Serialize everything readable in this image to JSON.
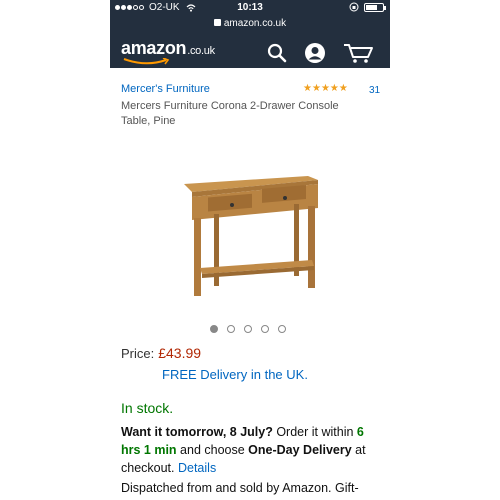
{
  "status_bar": {
    "carrier": "O2-UK",
    "time": "10:13",
    "url": "amazon.co.uk"
  },
  "header": {
    "logo_text": "amazon",
    "logo_tld": ".co.uk",
    "icons": [
      "search-icon",
      "account-icon",
      "cart-icon"
    ],
    "color_bg": "#232f3e"
  },
  "product": {
    "brand": "Mercer's Furniture",
    "rating_stars": 5,
    "rating_count": "31",
    "title": "Mercers Furniture Corona 2-Drawer Console Table, Pine",
    "image_count": 5,
    "image_active_index": 0
  },
  "pricing": {
    "price_label": "Price:",
    "price": "£43.99",
    "delivery": "FREE Delivery in the UK."
  },
  "availability": {
    "stock": "In stock.",
    "want_prefix": "Want it tomorrow, 8 July?",
    "want_mid": " Order it within ",
    "countdown": "6 hrs 1 min",
    "want_mid2": " and choose ",
    "one_day": "One-Day Delivery",
    "want_suffix": " at checkout. ",
    "details_link": "Details",
    "dispatch": "Dispatched from and sold by Amazon. Gift-"
  },
  "colors": {
    "link": "#0066c0",
    "price": "#b12704",
    "in_stock": "#007600",
    "star": "#f0a020"
  }
}
